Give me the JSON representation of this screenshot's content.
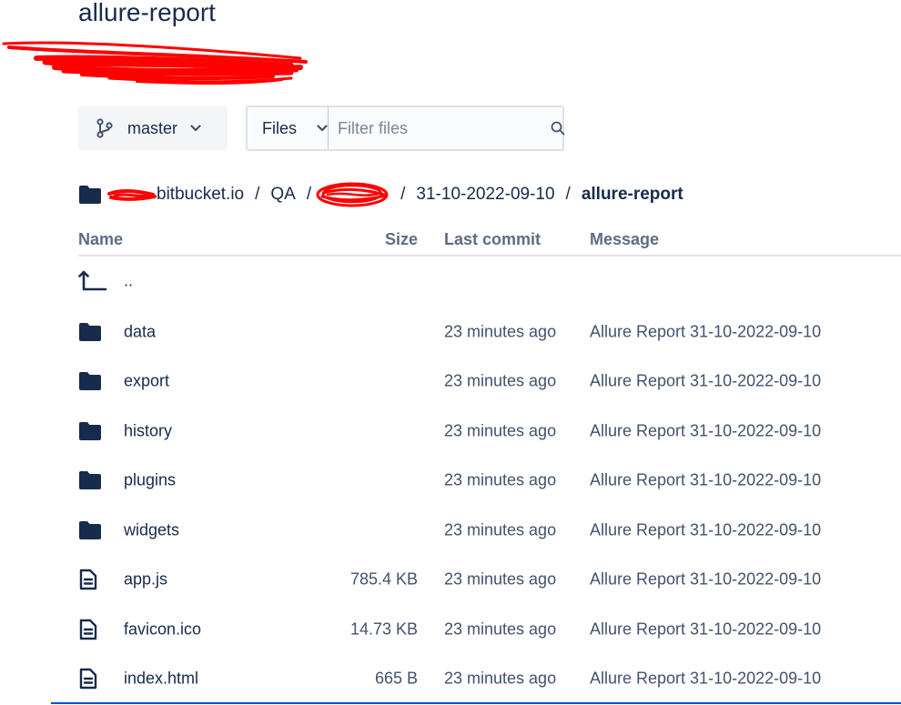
{
  "repo": {
    "title": "allure-report"
  },
  "branch": {
    "name": "master",
    "icon": "branch-icon"
  },
  "filter": {
    "type_label": "Files",
    "placeholder": "Filter files",
    "value": ""
  },
  "breadcrumb": {
    "root": "bitbucket.io",
    "items": [
      "QA",
      "31-10-2022-09-10"
    ],
    "current": "allure-report",
    "separator": "/"
  },
  "table": {
    "headers": {
      "name": "Name",
      "size": "Size",
      "commit": "Last commit",
      "message": "Message"
    },
    "parent": {
      "name": ".."
    },
    "rows": [
      {
        "type": "folder",
        "name": "data",
        "size": "",
        "commit": "23 minutes ago",
        "message": "Allure Report 31-10-2022-09-10"
      },
      {
        "type": "folder",
        "name": "export",
        "size": "",
        "commit": "23 minutes ago",
        "message": "Allure Report 31-10-2022-09-10"
      },
      {
        "type": "folder",
        "name": "history",
        "size": "",
        "commit": "23 minutes ago",
        "message": "Allure Report 31-10-2022-09-10"
      },
      {
        "type": "folder",
        "name": "plugins",
        "size": "",
        "commit": "23 minutes ago",
        "message": "Allure Report 31-10-2022-09-10"
      },
      {
        "type": "folder",
        "name": "widgets",
        "size": "",
        "commit": "23 minutes ago",
        "message": "Allure Report 31-10-2022-09-10"
      },
      {
        "type": "file",
        "name": "app.js",
        "size": "785.4 KB",
        "commit": "23 minutes ago",
        "message": "Allure Report 31-10-2022-09-10"
      },
      {
        "type": "file",
        "name": "favicon.ico",
        "size": "14.73 KB",
        "commit": "23 minutes ago",
        "message": "Allure Report 31-10-2022-09-10"
      },
      {
        "type": "file",
        "name": "index.html",
        "size": "665 B",
        "commit": "23 minutes ago",
        "message": "Allure Report 31-10-2022-09-10"
      }
    ]
  },
  "colors": {
    "text": "#172b4d",
    "muted": "#5e6c84",
    "icon": "#172b4d",
    "redaction": "#ff0000",
    "accent": "#0052cc"
  }
}
